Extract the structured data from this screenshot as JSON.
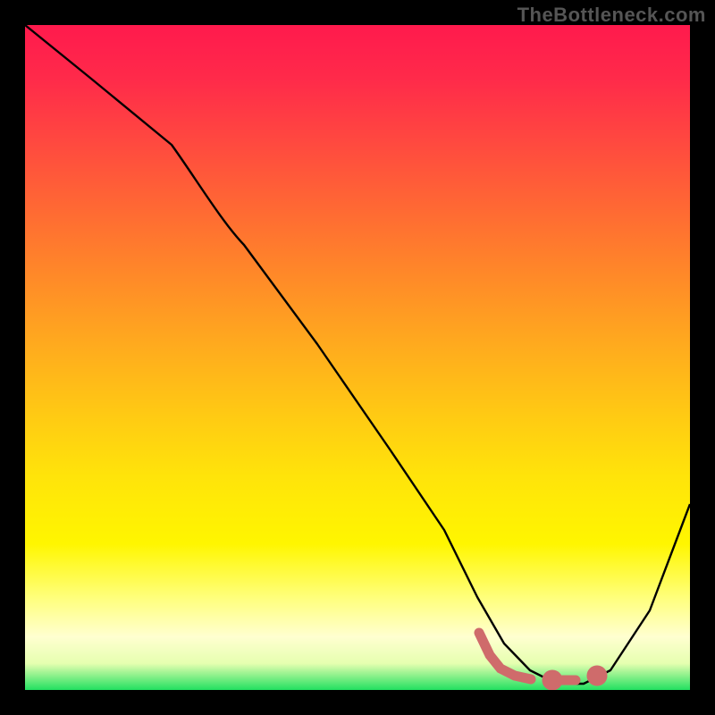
{
  "watermark": "TheBottleneck.com",
  "chart_data": {
    "type": "line",
    "title": "",
    "xlabel": "",
    "ylabel": "",
    "xlim": [
      0,
      100
    ],
    "ylim": [
      0,
      100
    ],
    "series": [
      {
        "name": "bottleneck-curve",
        "x": [
          0,
          10,
          22,
          33,
          44,
          55,
          63,
          68,
          72,
          76,
          80,
          84,
          88,
          94,
          100
        ],
        "y": [
          100,
          92,
          82,
          67,
          52,
          36,
          24,
          14,
          7,
          3,
          1,
          1,
          3,
          12,
          28
        ],
        "style": "solid"
      },
      {
        "name": "highlight-segment",
        "x": [
          68,
          70,
          72,
          74,
          76,
          78,
          80,
          82,
          84
        ],
        "y": [
          7.5,
          5,
          3.5,
          2.5,
          2,
          1.8,
          1.8,
          2,
          2.5
        ],
        "style": "marker-band"
      }
    ],
    "colors": {
      "curve": "#000000",
      "highlight": "#d36a6a",
      "background_top": "#ff1a4d",
      "background_bottom": "#22e060"
    }
  }
}
